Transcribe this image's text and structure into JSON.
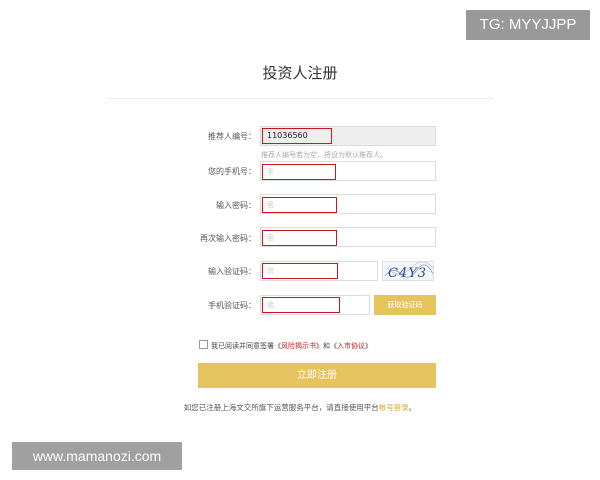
{
  "watermarks": {
    "top_right": "TG: MYYJJPP",
    "bottom_left": "www.mamanozi.com"
  },
  "page": {
    "title": "投资人注册"
  },
  "form": {
    "referrer": {
      "label": "推荐人编号：",
      "value": "11036560",
      "hint": "推荐人编号若为空，将设为默认推荐人。"
    },
    "phone": {
      "label": "您的手机号：",
      "placeholder": "手"
    },
    "password": {
      "label": "输入密码：",
      "placeholder": "密"
    },
    "password_confirm": {
      "label": "再次输入密码：",
      "placeholder": "密"
    },
    "captcha": {
      "label": "输入验证码：",
      "placeholder": "验",
      "image_text": "C4Y3"
    },
    "sms_code": {
      "label": "手机验证码：",
      "placeholder": "验",
      "button_label": "获取验证码"
    },
    "agreement": {
      "prefix": "我已阅读并同意签署《",
      "risk_doc": "风险揭示书",
      "middle": "》和《",
      "market_doc": "入市协议",
      "suffix": "》"
    },
    "submit_label": "立即注册"
  },
  "footer": {
    "text": "如您已注册上海文交所旗下运营服务平台，请直接使用平台",
    "link": "帐号登录",
    "end": "。"
  },
  "colors": {
    "accent": "#e5c35d",
    "highlight": "#c8161d",
    "link": "#d4a72c"
  }
}
